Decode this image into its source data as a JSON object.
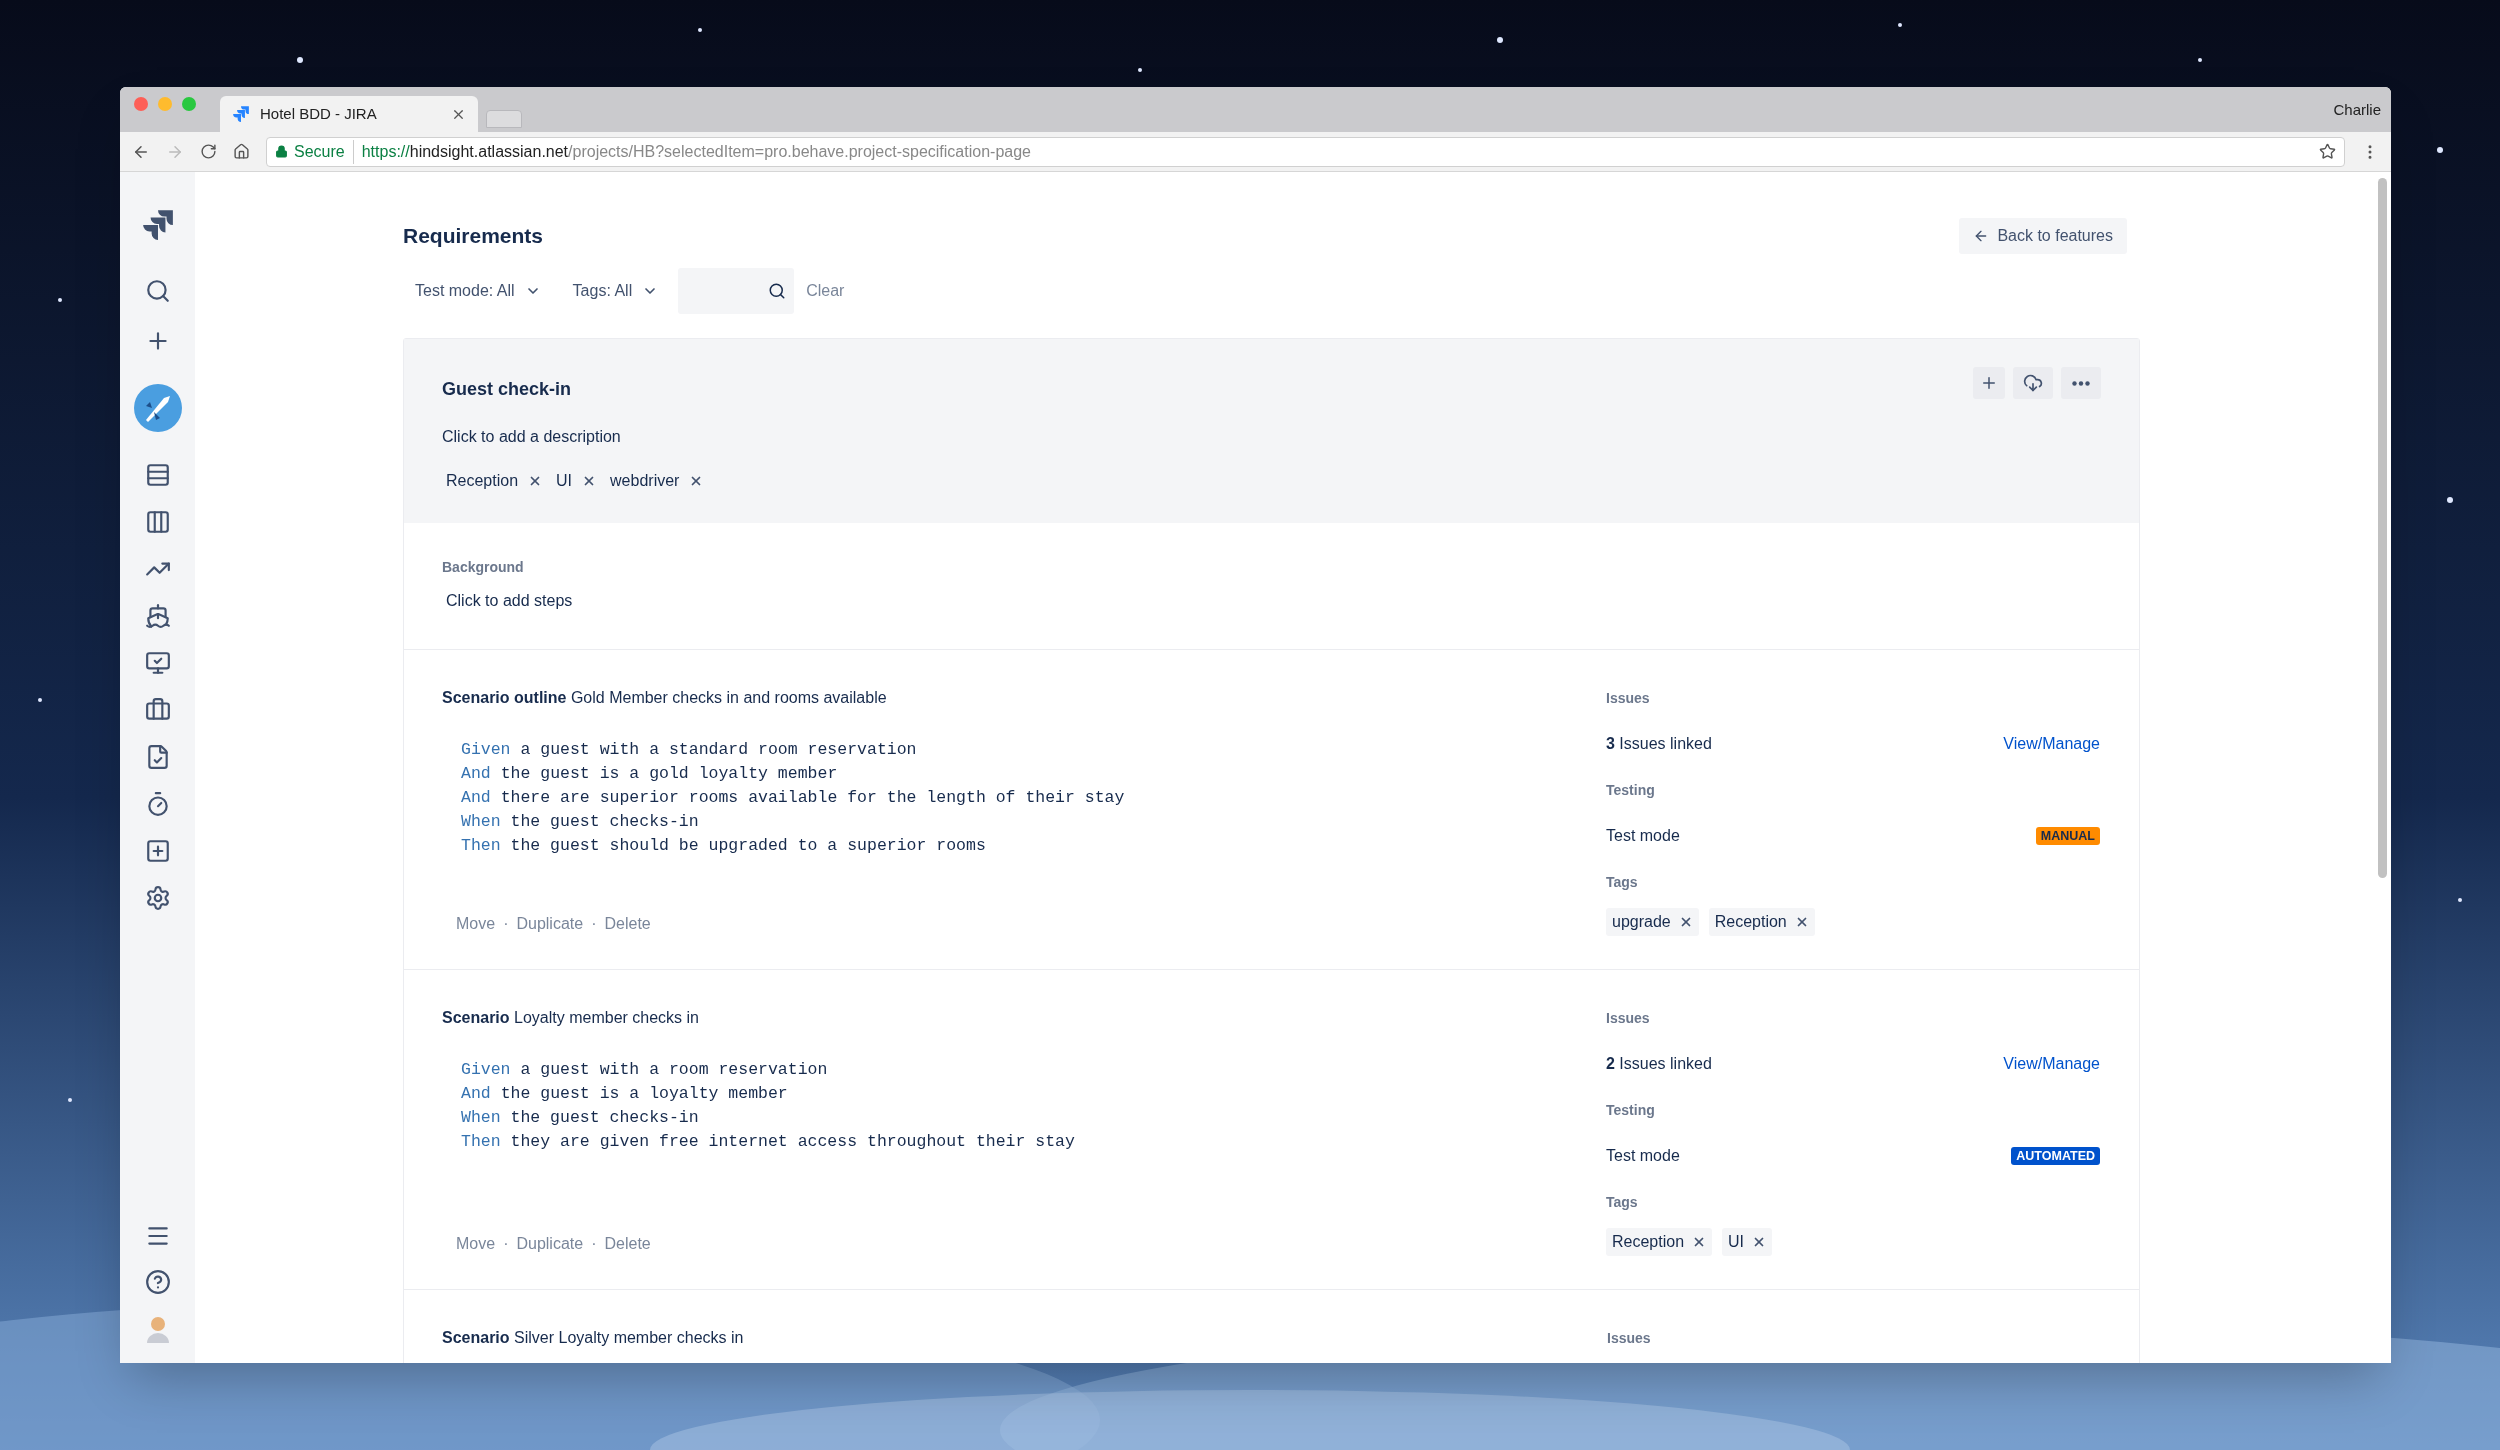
{
  "browser": {
    "tab_title": "Hotel BDD - JIRA",
    "profile": "Charlie",
    "url": {
      "security": "Secure",
      "scheme": "https://",
      "host": "hindsight.atlassian.net",
      "path": "/projects/HB?selectedItem=pro.behave.project-specification-page"
    }
  },
  "page": {
    "title": "Requirements",
    "back_button": "Back to features",
    "filters": [
      {
        "label": "Test mode: All"
      },
      {
        "label": "Tags: All"
      }
    ],
    "clear": "Clear"
  },
  "feature": {
    "title": "Guest check-in",
    "description": "Click to add a description",
    "tags": [
      "Reception",
      "UI",
      "webdriver"
    ],
    "background": {
      "label": "Background",
      "steps": "Click to add steps"
    }
  },
  "action_separator": "·",
  "scenarios": [
    {
      "heading": "**Scenario outline** Gold Member checks in and rooms available",
      "steps": [
        {
          "keyword": "Given",
          "text": "a guest with a standard room reservation"
        },
        {
          "keyword": "And",
          "text": "the guest is a gold loyalty member"
        },
        {
          "keyword": "And",
          "text": "there are superior rooms available for the length of their stay"
        },
        {
          "keyword": "When",
          "text": "the guest checks-in"
        },
        {
          "keyword": "Then",
          "text": "the guest should be upgraded to a superior rooms"
        }
      ],
      "actions": [
        "Move",
        "Duplicate",
        "Delete"
      ],
      "issues_label": "Issues",
      "issues_linked": "**3** Issues linked",
      "view_link": "View/Manage",
      "testing_label": "Testing",
      "test_mode_label": "Test mode",
      "test_mode": {
        "kind": "manual",
        "label": "MANUAL"
      },
      "tags_label": "Tags",
      "tags": [
        "upgrade",
        "Reception"
      ]
    },
    {
      "heading": "**Scenario** Loyalty member checks in",
      "steps": [
        {
          "keyword": "Given",
          "text": "a guest with a room reservation"
        },
        {
          "keyword": "And",
          "text": "the guest is a loyalty member"
        },
        {
          "keyword": "When",
          "text": "the guest checks-in"
        },
        {
          "keyword": "Then",
          "text": "they are given free internet access throughout their stay"
        }
      ],
      "actions": [
        "Move",
        "Duplicate",
        "Delete"
      ],
      "issues_label": "Issues",
      "issues_linked": "**2** Issues linked",
      "view_link": "View/Manage",
      "testing_label": "Testing",
      "test_mode_label": "Test mode",
      "test_mode": {
        "kind": "automated",
        "label": "AUTOMATED"
      },
      "tags_label": "Tags",
      "tags": [
        "Reception",
        "UI"
      ]
    },
    {
      "heading": "**Scenario** Silver Loyalty member checks in",
      "issues_label": "Issues"
    }
  ]
}
